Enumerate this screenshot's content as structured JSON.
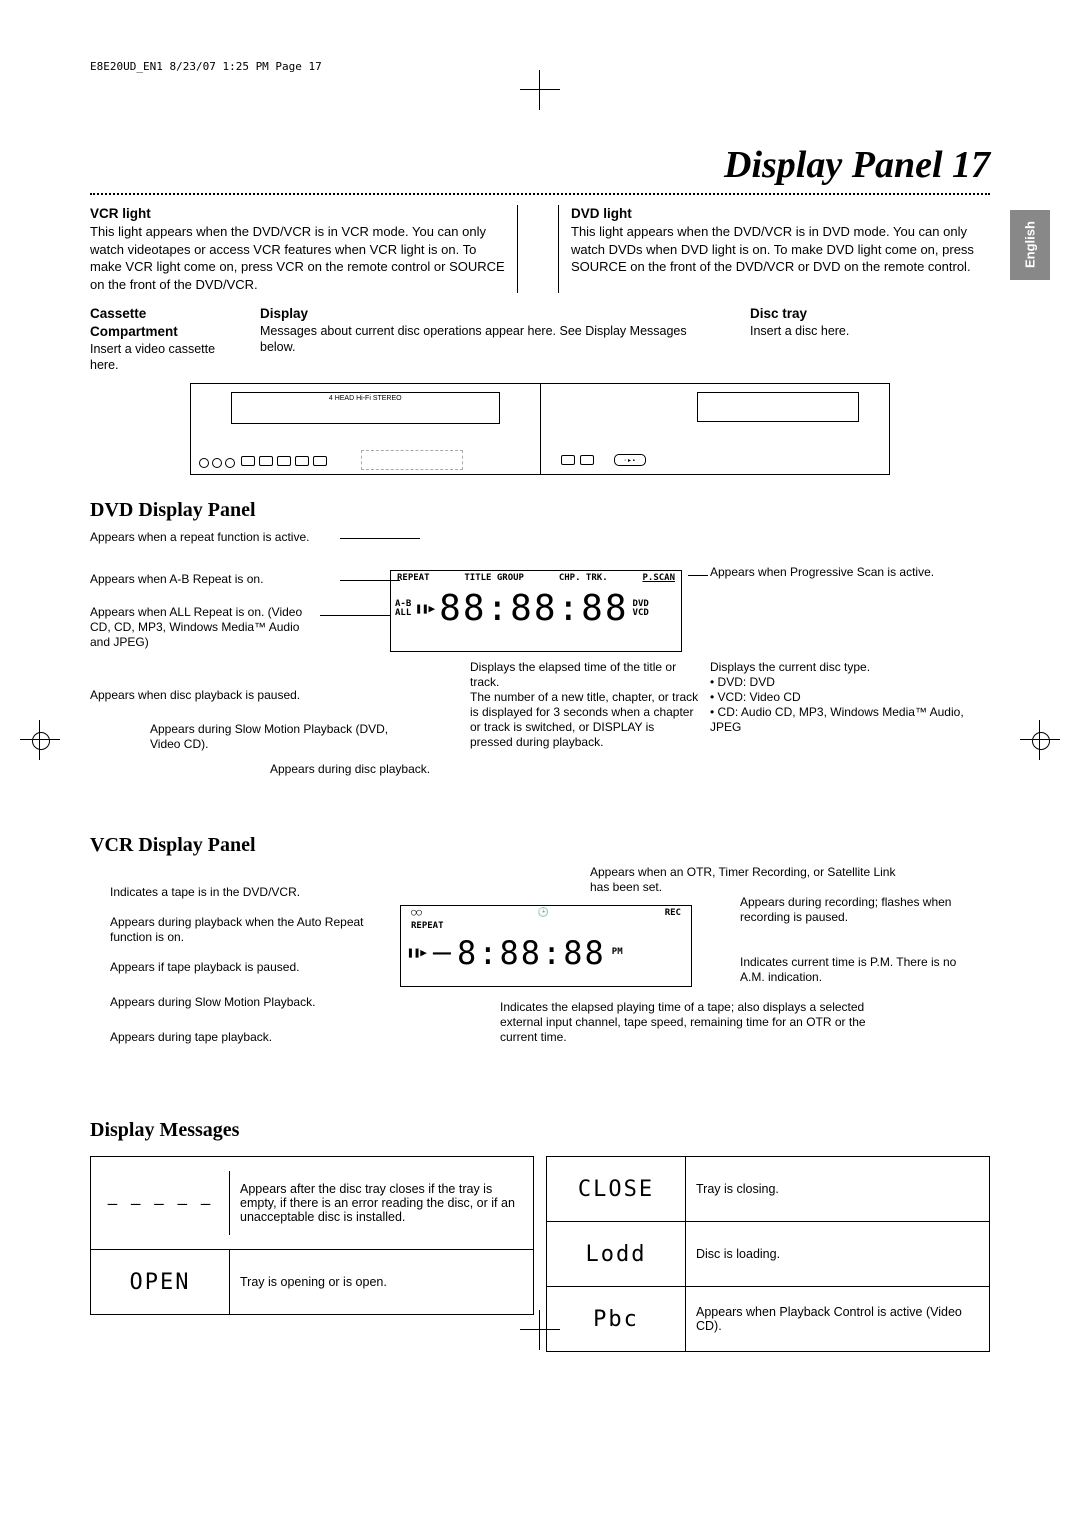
{
  "header": "E8E20UD_EN1  8/23/07  1:25 PM  Page 17",
  "title": "Display Panel   17",
  "tab": "English",
  "vcr_light": {
    "heading": "VCR light",
    "text": "This light appears when the DVD/VCR is in VCR mode. You can only watch videotapes or access VCR features when VCR light is on. To make VCR light come on, press VCR on the remote control or SOURCE on the front of the DVD/VCR."
  },
  "dvd_light": {
    "heading": "DVD light",
    "text": "This light appears when the DVD/VCR is in DVD mode. You can only watch DVDs when DVD light is on. To make DVD light come on, press SOURCE on the front of the DVD/VCR or DVD on the remote control."
  },
  "cassette": {
    "heading": "Cassette Compartment",
    "text": "Insert a video cassette here."
  },
  "display_label": {
    "heading": "Display",
    "text": "Messages about current disc operations appear here. See Display Messages below."
  },
  "disc_tray": {
    "heading": "Disc tray",
    "text": "Insert a disc here."
  },
  "unit_text": "4 HEAD Hi-Fi STEREO",
  "dvd_panel_heading": "DVD Display Panel",
  "dvd_panel": {
    "repeat_active": "Appears when a repeat function is active.",
    "ab_repeat": "Appears when A-B Repeat is on.",
    "all_repeat": "Appears when ALL Repeat is on. (Video CD, CD, MP3, Windows Media™ Audio and JPEG)",
    "paused": "Appears when disc playback is paused.",
    "slow": "Appears during Slow Motion Playback (DVD, Video CD).",
    "during_play": "Appears during disc playback.",
    "elapsed": "Displays the elapsed time of the title or track.\nThe number of a new title, chapter, or track is displayed for 3 seconds when a chapter or track is switched, or DISPLAY is pressed during playback.",
    "pscan": "Appears when Progressive Scan is active.",
    "disc_type": "Displays the current disc type.",
    "disc_type_items": [
      "DVD: DVD",
      "VCD: Video CD",
      "CD:   Audio CD, MP3, Windows Media™ Audio, JPEG"
    ],
    "indicators": [
      "REPEAT",
      "TITLE GROUP",
      "CHP. TRK.",
      "P.SCAN",
      "A-B",
      "ALL",
      "DVD",
      "VCD"
    ]
  },
  "vcr_panel_heading": "VCR Display Panel",
  "vcr_panel": {
    "tape_in": "Indicates a tape is in the DVD/VCR.",
    "auto_repeat": "Appears during playback when the Auto Repeat function is on.",
    "paused": "Appears if tape playback is paused.",
    "slow": "Appears during Slow Motion Playback.",
    "during_play": "Appears during tape playback.",
    "otr": "Appears when an OTR, Timer Recording, or Satellite Link has been set.",
    "rec": "Appears during recording; flashes when recording is paused.",
    "pm": "Indicates current time is P.M. There is no A.M. indication.",
    "elapsed": "Indicates the elapsed playing time of a tape; also displays a selected external input channel, tape speed, remaining time for an OTR or the current time.",
    "indicators": [
      "REPEAT",
      "REC",
      "PM"
    ]
  },
  "display_messages_heading": "Display Messages",
  "messages": [
    {
      "icon": "– – – – –",
      "text": "Appears after the disc tray closes if the tray is empty, if there is an error reading the disc, or if an unacceptable disc is installed."
    },
    {
      "icon": "OPEN",
      "text": "Tray is opening or is open."
    },
    {
      "icon": "CLOSE",
      "text": "Tray is closing."
    },
    {
      "icon": "Lodd",
      "text": "Disc is loading."
    },
    {
      "icon": "Pbc",
      "text": "Appears when Playback Control is active (Video CD)."
    }
  ]
}
